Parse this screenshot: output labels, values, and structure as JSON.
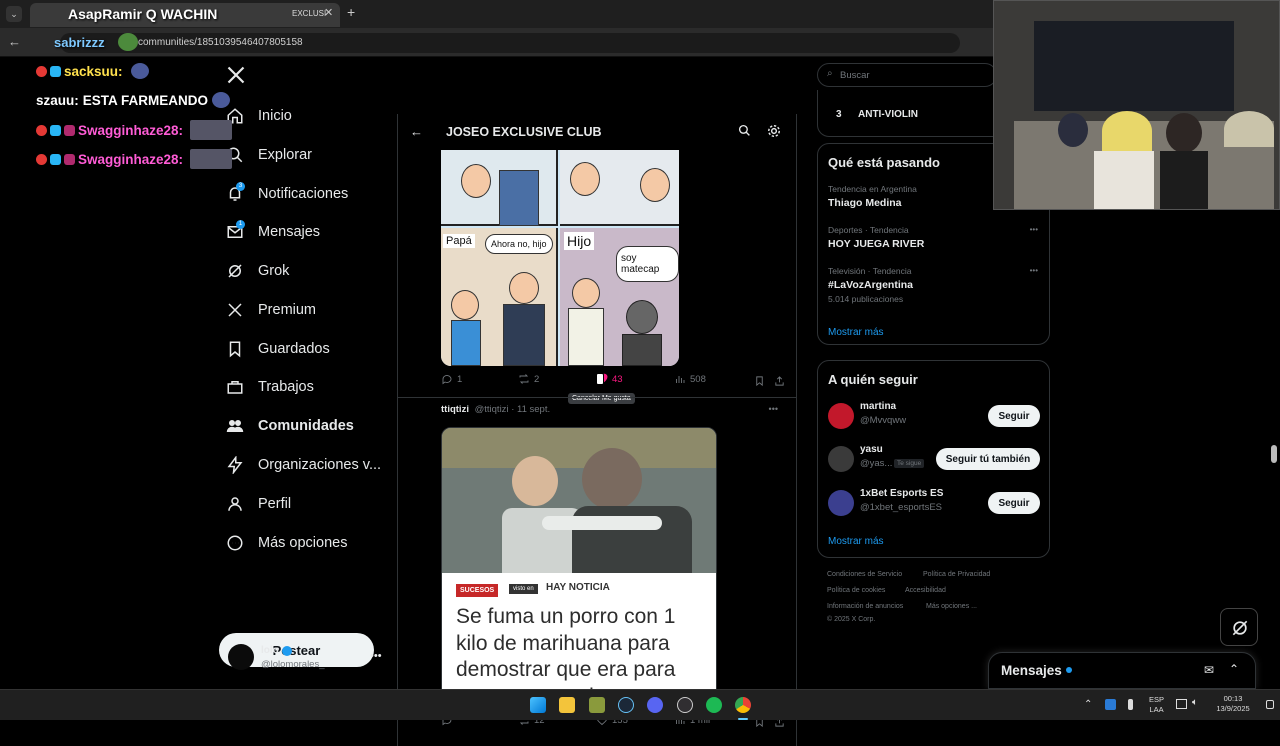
{
  "browser": {
    "tab_title": "EXCLUSI",
    "overlay_tab_text": "AsapRamir Q WACHIN",
    "url": "communities/1851039546407805158",
    "overlay_url_text": "sabrizzz"
  },
  "chat": [
    {
      "user": "sacksuu:",
      "text": ""
    },
    {
      "user": "szauu:",
      "text": "ESTA FARMEANDO"
    },
    {
      "user": "Swagginhaze28:",
      "text": ""
    },
    {
      "user": "Swagginhaze28:",
      "text": ""
    }
  ],
  "sidebar": {
    "items": [
      {
        "label": "Inicio",
        "icon": "home-icon"
      },
      {
        "label": "Explorar",
        "icon": "search-icon"
      },
      {
        "label": "Notificaciones",
        "icon": "bell-icon",
        "badge": "3"
      },
      {
        "label": "Mensajes",
        "icon": "mail-icon",
        "badge": "1"
      },
      {
        "label": "Grok",
        "icon": "grok-icon"
      },
      {
        "label": "Premium",
        "icon": "x-icon"
      },
      {
        "label": "Guardados",
        "icon": "bookmark-icon"
      },
      {
        "label": "Trabajos",
        "icon": "briefcase-icon"
      },
      {
        "label": "Comunidades",
        "icon": "people-icon"
      },
      {
        "label": "Organizaciones v...",
        "icon": "bolt-icon"
      },
      {
        "label": "Perfil",
        "icon": "person-icon"
      },
      {
        "label": "Más opciones",
        "icon": "more-icon"
      }
    ],
    "post_button": "Postear",
    "account": {
      "name": "lolo",
      "handle": "@lolomorales_"
    }
  },
  "feed": {
    "title": "JOSEO EXCLUSIVE CLUB",
    "post1": {
      "comic_labels": [
        "Papá",
        "Ahora no, hijo",
        "Hijo",
        "soy matecap"
      ],
      "replies": "1",
      "reposts": "2",
      "likes": "43",
      "views": "508",
      "tooltip": "Cancelar Me gusta"
    },
    "post2": {
      "author": "ttiqtizi",
      "handle": "@ttiqtizi",
      "date": "11 sept.",
      "tag": "SUCESOS",
      "source_prefix": "visto en",
      "source": "HAY NOTICIA",
      "headline": "Se fuma un porro con 1 kilo de marihuana para demostrar que era para consumo propio",
      "reposts": "12",
      "likes": "155",
      "views": "1 mil"
    }
  },
  "right": {
    "search_placeholder": "Buscar",
    "rule_number": "3",
    "rule_text": "ANTI-VIOLIN",
    "trends_title": "Qué está pasando",
    "trends": [
      {
        "category": "Tendencia en Argentina",
        "name": "Thiago Medina",
        "count": ""
      },
      {
        "category": "Deportes · Tendencia",
        "name": "HOY JUEGA RIVER",
        "count": ""
      },
      {
        "category": "Televisión · Tendencia",
        "name": "#LaVozArgentina",
        "count": "5.014 publicaciones"
      }
    ],
    "show_more": "Mostrar más",
    "follow_title": "A quién seguir",
    "follow": [
      {
        "name": "martina",
        "handle": "@Mvvqww",
        "button": "Seguir",
        "tag": ""
      },
      {
        "name": "yasu",
        "handle": "@yas...",
        "button": "Seguir tú también",
        "tag": "Te sigue"
      },
      {
        "name": "1xBet Esports ES",
        "handle": "@1xbet_esportsES",
        "button": "Seguir",
        "tag": ""
      }
    ],
    "show_more_2": "Mostrar más",
    "footer": [
      "Condiciones de Servicio",
      "Política de Privacidad",
      "Política de cookies",
      "Accesibilidad",
      "Información de anuncios",
      "Más opciones ...",
      "© 2025 X Corp."
    ],
    "messages_label": "Mensajes"
  },
  "taskbar": {
    "lang1": "ESP",
    "lang2": "LAA",
    "time": "00:13",
    "date": "13/9/2025"
  },
  "colors": {
    "accent": "#1d9bf0",
    "like": "#f91880",
    "chat_user": "#ff5cd6"
  }
}
